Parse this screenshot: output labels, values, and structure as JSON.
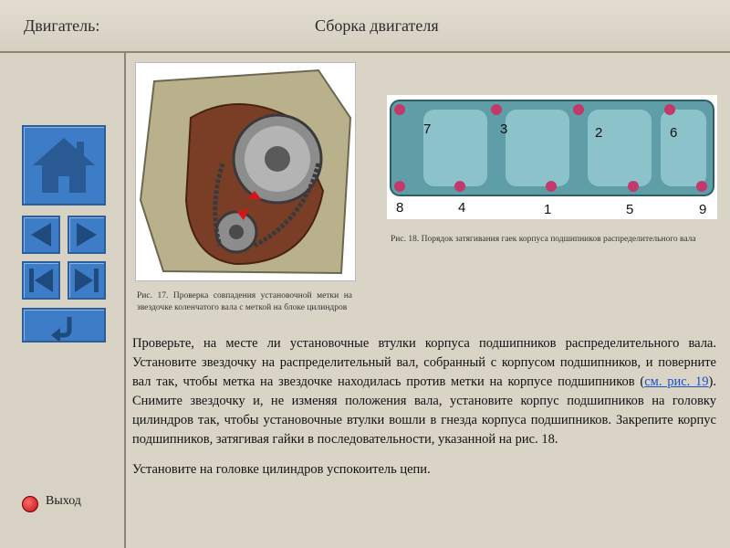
{
  "header": {
    "section_title": "Двигатель:",
    "page_title": "Сборка двигателя"
  },
  "sidebar": {
    "home_icon": "home-icon",
    "prev_icon": "arrow-left-icon",
    "next_icon": "arrow-right-icon",
    "first_icon": "skip-first-icon",
    "last_icon": "skip-last-icon",
    "back_icon": "return-icon",
    "exit_label": "Выход",
    "accent_color": "#3d7dc7",
    "exit_color": "#c01010"
  },
  "figures": {
    "fig17_caption": "Рис. 17. Проверка совпадения установочной метки на звездочке коленчатого вала с меткой на блоке цилиндров",
    "fig18_caption": "Рис. 18. Порядок затягивания гаек корпуса подшипников распределительного вала",
    "fig18_labels_top": [
      "7",
      "3",
      "2",
      "6"
    ],
    "fig18_labels_bottom": [
      "8",
      "4",
      "1",
      "5",
      "9"
    ]
  },
  "content": {
    "p1_before": "Проверьте, на месте ли установочные втулки корпуса подшипников распределительного вала. Установите звездочку на распределительный вал, собранный с корпусом подшипников, и поверните вал так, чтобы метка на звездочке находилась против метки на корпусе подшипников (",
    "p1_link": "см. рис. 19",
    "p1_after": "). Снимите звездочку и, не изменяя положения вала, установите корпус подшипников на головку цилиндров так, чтобы установочные втулки вошли в гнезда корпуса подшипников. Закрепите корпус подшипников, затягивая гайки в последовательности, указанной на рис. 18.",
    "p2": "Установите на головке цилиндров успокоитель цепи."
  }
}
